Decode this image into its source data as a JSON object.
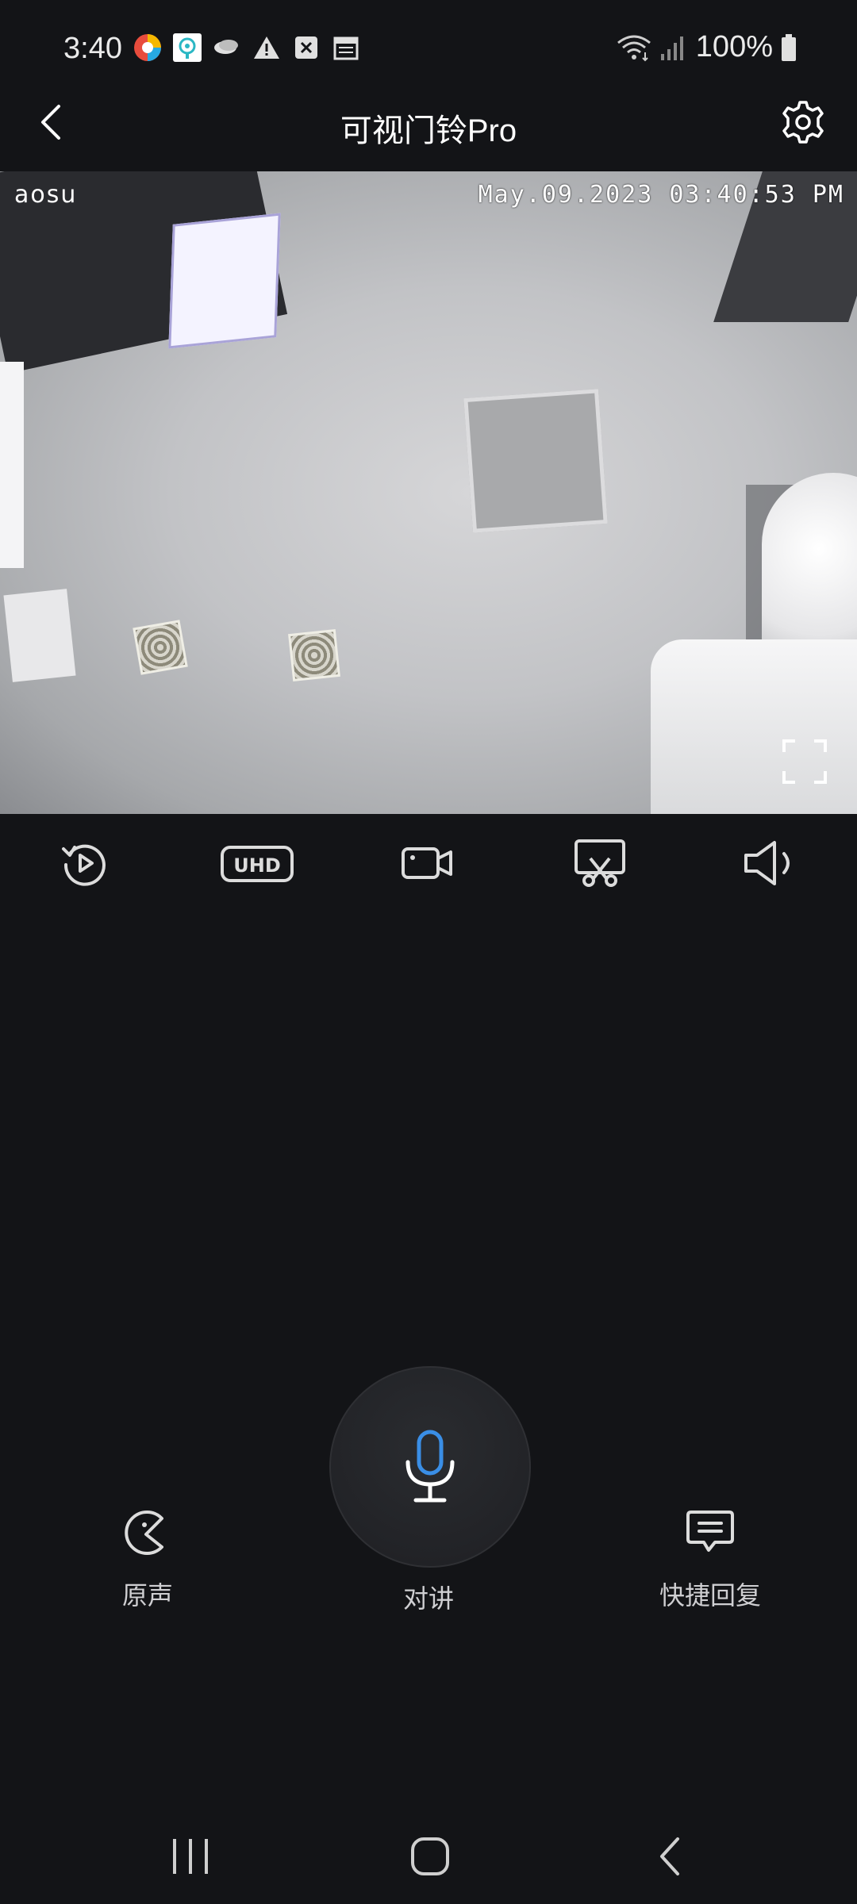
{
  "status_bar": {
    "time": "3:40",
    "battery": "100%",
    "notification_icons": [
      "color-app-icon",
      "location-app-icon",
      "cloud-app-icon",
      "warning-icon",
      "close-box-icon",
      "calendar-icon"
    ],
    "system_icons": [
      "wifi-icon",
      "signal-icon",
      "battery-icon"
    ]
  },
  "header": {
    "title": "可视门铃Pro",
    "back_icon": "chevron-left-icon",
    "settings_icon": "gear-icon"
  },
  "video": {
    "brand": "aosu",
    "timestamp": "May.09.2023 03:40:53 PM",
    "fullscreen_icon": "fullscreen-icon"
  },
  "toolbar": {
    "items": [
      {
        "name": "playback",
        "icon": "replay-icon"
      },
      {
        "name": "quality",
        "label": "UHD"
      },
      {
        "name": "record",
        "icon": "video-camera-icon"
      },
      {
        "name": "screenshot",
        "icon": "scissors-icon"
      },
      {
        "name": "sound",
        "icon": "speaker-icon"
      }
    ]
  },
  "actions": {
    "original_voice": "原声",
    "talk": "对讲",
    "quick_reply": "快捷回复"
  },
  "colors": {
    "background": "#131417",
    "accent": "#3a8ee6",
    "text": "#ffffff"
  }
}
